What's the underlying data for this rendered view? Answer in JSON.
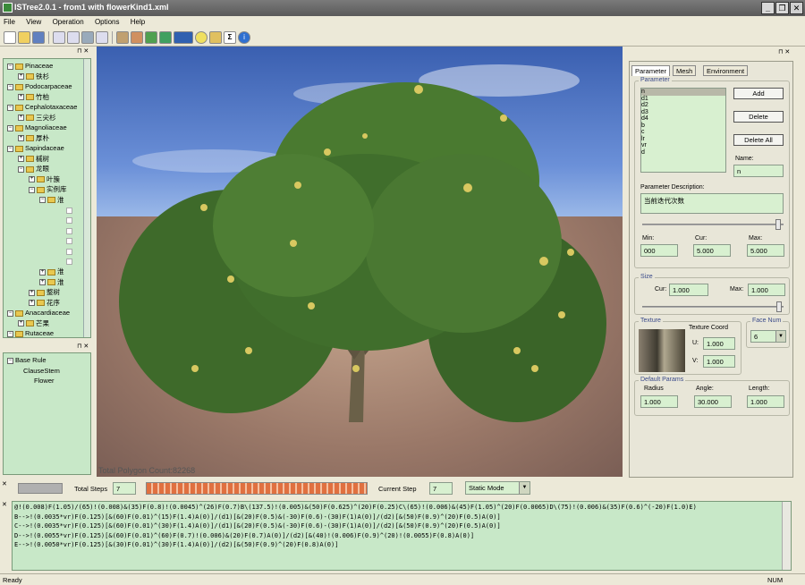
{
  "window": {
    "title": "ISTree2.0.1 - from1 with flowerKind1.xml"
  },
  "menu": {
    "items": [
      "File",
      "View",
      "Operation",
      "Options",
      "Help"
    ]
  },
  "toolbar": {
    "icons": [
      "new-icon",
      "open-icon",
      "save-icon",
      "copy-icon",
      "paste-icon",
      "render-icon",
      "export-icon",
      "texture-icon",
      "brush-icon",
      "refresh-icon",
      "snapshot-icon",
      "display-mode-icon",
      "light-icon",
      "pencil-icon",
      "sigma-icon",
      "info-icon"
    ]
  },
  "species_tree": {
    "items": [
      {
        "label": "Pinaceae",
        "level": 0
      },
      {
        "label": "铁杉",
        "level": 1
      },
      {
        "label": "Podocarpaceae",
        "level": 0
      },
      {
        "label": "竹柏",
        "level": 1
      },
      {
        "label": "Cephalotaxaceae",
        "level": 0
      },
      {
        "label": "三尖杉",
        "level": 1
      },
      {
        "label": "Magnoliaceae",
        "level": 0
      },
      {
        "label": "厚朴",
        "level": 1
      },
      {
        "label": "Sapindaceae",
        "level": 0
      },
      {
        "label": "槭树",
        "level": 1
      },
      {
        "label": "龙眼",
        "level": 1
      },
      {
        "label": "叶簇",
        "level": 2
      },
      {
        "label": "实例库",
        "level": 2
      },
      {
        "label": "淮",
        "level": 3
      },
      {
        "label": "",
        "level": 4
      },
      {
        "label": "",
        "level": 4
      },
      {
        "label": "",
        "level": 4
      },
      {
        "label": "",
        "level": 4
      },
      {
        "label": "",
        "level": 4
      },
      {
        "label": "",
        "level": 4
      },
      {
        "label": "淮",
        "level": 3
      },
      {
        "label": "淮",
        "level": 3
      },
      {
        "label": "整树",
        "level": 2
      },
      {
        "label": "花序",
        "level": 2
      },
      {
        "label": "Anacardiaceae",
        "level": 0
      },
      {
        "label": "芒果",
        "level": 1
      },
      {
        "label": "Rutaceae",
        "level": 0
      }
    ]
  },
  "rule_tree": {
    "items": [
      {
        "label": "Base Rule",
        "level": 0
      },
      {
        "label": "ClauseStem",
        "level": 1
      },
      {
        "label": "Flower",
        "level": 2
      }
    ]
  },
  "viewport": {
    "polygon_count": "Total Polygon Count:82268"
  },
  "right_panel": {
    "tabs": [
      "Parameter",
      "Mesh",
      "Environment"
    ],
    "parameter_group_label": "Parameter",
    "parameters": [
      "n",
      "d1",
      "d2",
      "d3",
      "d4",
      "b",
      "c",
      "lr",
      "vr",
      "d"
    ],
    "selected_parameter": "n",
    "add_label": "Add",
    "delete_label": "Delete",
    "delete_all_label": "Delete All",
    "name_label": "Name:",
    "name_value": "n",
    "description_label": "Parameter Description:",
    "description_value": "当前迭代次数",
    "min_label": "Min:",
    "min_value": "000",
    "cur_label": "Cur:",
    "cur_value": "5.000",
    "max_label": "Max:",
    "max_value": "5.000",
    "size_group_label": "Size",
    "size_cur_label": "Cur:",
    "size_cur_value": "1.000",
    "size_max_label": "Max:",
    "size_max_value": "1.000",
    "texture_group_label": "Texture",
    "texture_coord_label": "Texture Coord",
    "u_label": "U:",
    "u_value": "1.000",
    "v_label": "V:",
    "v_value": "1.000",
    "face_num_label": "Face Num",
    "face_num_value": "6",
    "default_params_label": "Default Params",
    "radius_label": "Radius",
    "radius_value": "1.000",
    "angle_label": "Angle:",
    "angle_value": "30.000",
    "length_label": "Length:",
    "length_value": "1.000"
  },
  "playback": {
    "total_steps_label": "Total Steps",
    "total_steps_value": "7",
    "progress": 1.0,
    "current_step_label": "Current Step",
    "current_step_value": "7",
    "mode_value": "Static Mode"
  },
  "rules_text": [
    "@!(0.008)F(1.05)/(65)!(0.008)&(35)F(0.8)!(0.0045)^(26)F(0.7)B\\(137.5)!(0.005)&(50)F(0.625)^(20)F(0.25)C\\(65)!(0.006)&(45)F(1.05)^(20)F(0.0065)D\\(75)!(0.006)&(35)F(0.6)^(-20)F(1.0)E)",
    "B-->!(0.0035*vr)F(0.125)[&(60)F(0.01)^(15)F(1.4)A(0)]/(d1)[&(20)F(0.5)&(-30)F(0.6)-(30)F(1)A(0)]/(d2)[&(50)F(0.9)^(20)F(0.5)A(0)]",
    "C-->!(0.0035*vr)F(0.125)[&(60)F(0.01)^(30)F(1.4)A(0)]/(d1)[&(20)F(0.5)&(-30)F(0.6)-(30)F(1)A(0)]/(d2)[&(50)F(0.9)^(20)F(0.5)A(0)]",
    "D-->!(0.0055*vr)F(0.125)[&(60)F(0.01)^(60)F(0.7)!(0.006)&(20)F(0.7)A(0)]/(d2)[&(40)!(0.006)F(0.9)^(20)!(0.0055)F(0.8)A(0)]",
    "E-->!(0.0050*vr)F(0.125)[&(30)F(0.01)^(30)F(1.4)A(0)]/(d2)[&(50)F(0.9)^(20)F(0.8)A(0)]"
  ],
  "status": {
    "left": "Ready",
    "right": "NUM"
  }
}
